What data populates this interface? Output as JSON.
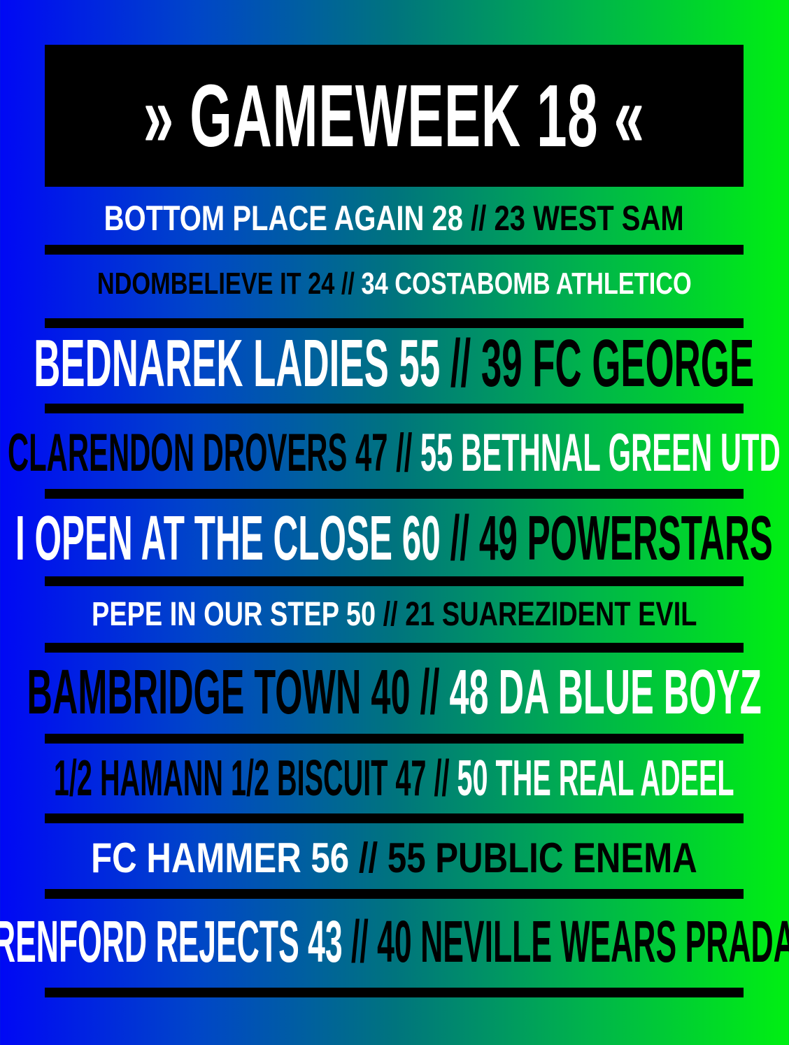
{
  "title": "» GAMEWEEK 18 «",
  "colors": {
    "gradient_left": "#0008f5",
    "gradient_right": "#00f012",
    "banner": "#000000",
    "text_light": "#ffffff",
    "text_dark": "#000000"
  },
  "fixtures": [
    {
      "home": "BOTTOM PLACE AGAIN",
      "home_score": "28",
      "sep": "//",
      "away_score": "23",
      "away": "WEST SAM"
    },
    {
      "home": "NDOMBELIEVE IT",
      "home_score": "24",
      "sep": "//",
      "away_score": "34",
      "away": "COSTABOMB ATHLETICO"
    },
    {
      "home": "BEDNAREK LADIES",
      "home_score": "55",
      "sep": "//",
      "away_score": "39",
      "away": "FC GEORGE"
    },
    {
      "home": "CLARENDON DROVERS",
      "home_score": "47",
      "sep": "//",
      "away_score": "55",
      "away": "BETHNAL GREEN UTD"
    },
    {
      "home": "I OPEN AT THE CLOSE",
      "home_score": "60",
      "sep": "//",
      "away_score": "49",
      "away": "POWERSTARS"
    },
    {
      "home": "PEPE IN OUR STEP",
      "home_score": "50",
      "sep": "//",
      "away_score": "21",
      "away": "SUAREZIDENT EVIL"
    },
    {
      "home": "BAMBRIDGE TOWN",
      "home_score": "40",
      "sep": "//",
      "away_score": "48",
      "away": "DA BLUE BOYZ"
    },
    {
      "home": "1/2 HAMANN 1/2 BISCUIT",
      "home_score": "47",
      "sep": "//",
      "away_score": "50",
      "away": "THE REAL ADEEL"
    },
    {
      "home": "FC HAMMER",
      "home_score": "56",
      "sep": "//",
      "away_score": "55",
      "away": "PUBLIC ENEMA"
    },
    {
      "home": "RENFORD REJECTS",
      "home_score": "43",
      "sep": "//",
      "away_score": "40",
      "away": "NEVILLE WEARS PRADA"
    }
  ]
}
